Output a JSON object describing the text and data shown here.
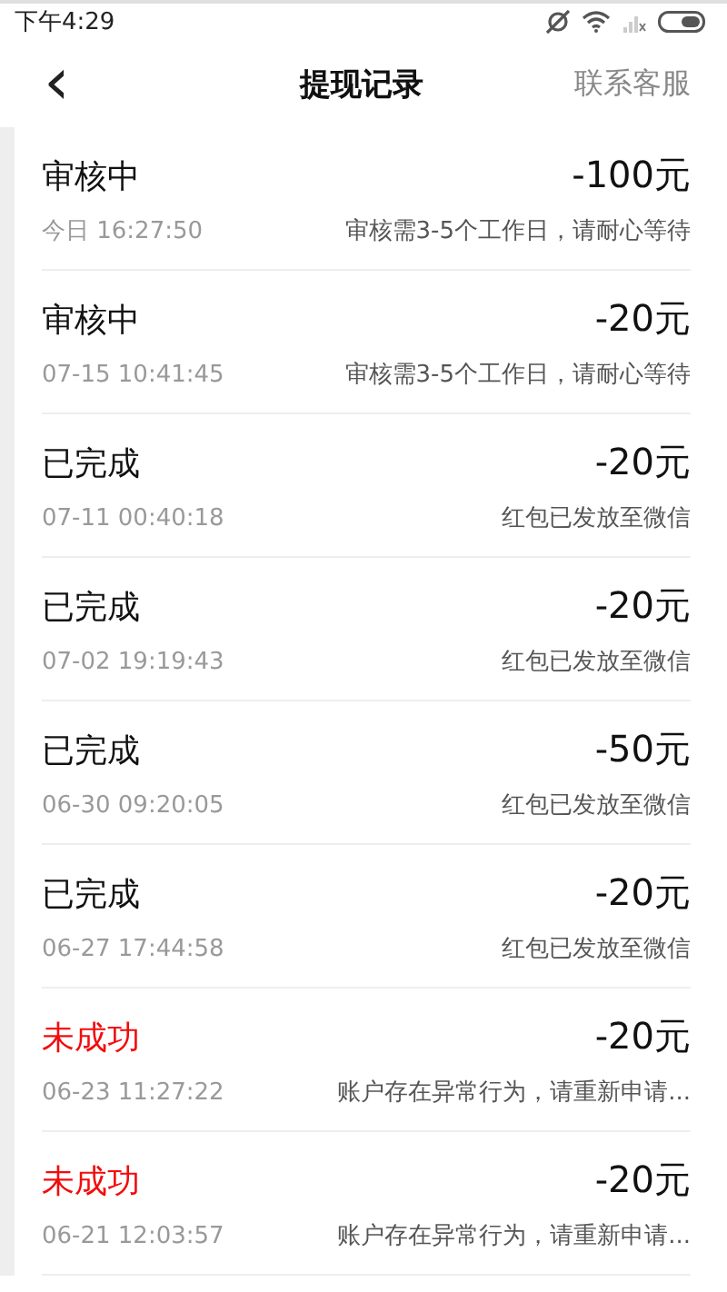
{
  "status_bar": {
    "time": "下午4:29"
  },
  "header": {
    "back": "‹",
    "title": "提现记录",
    "action": "联系客服"
  },
  "records": [
    {
      "kind": "pending",
      "status": "审核中",
      "amount": "-100元",
      "time": "今日 16:27:50",
      "note": "审核需3-5个工作日，请耐心等待"
    },
    {
      "kind": "pending",
      "status": "审核中",
      "amount": "-20元",
      "time": "07-15 10:41:45",
      "note": "审核需3-5个工作日，请耐心等待"
    },
    {
      "kind": "done",
      "status": "已完成",
      "amount": "-20元",
      "time": "07-11 00:40:18",
      "note": "红包已发放至微信"
    },
    {
      "kind": "done",
      "status": "已完成",
      "amount": "-20元",
      "time": "07-02 19:19:43",
      "note": "红包已发放至微信"
    },
    {
      "kind": "done",
      "status": "已完成",
      "amount": "-50元",
      "time": "06-30 09:20:05",
      "note": "红包已发放至微信"
    },
    {
      "kind": "done",
      "status": "已完成",
      "amount": "-20元",
      "time": "06-27 17:44:58",
      "note": "红包已发放至微信"
    },
    {
      "kind": "failed",
      "status": "未成功",
      "amount": "-20元",
      "time": "06-23 11:27:22",
      "note": "账户存在异常行为，请重新申请..."
    },
    {
      "kind": "failed",
      "status": "未成功",
      "amount": "-20元",
      "time": "06-21 12:03:57",
      "note": "账户存在异常行为，请重新申请..."
    }
  ]
}
